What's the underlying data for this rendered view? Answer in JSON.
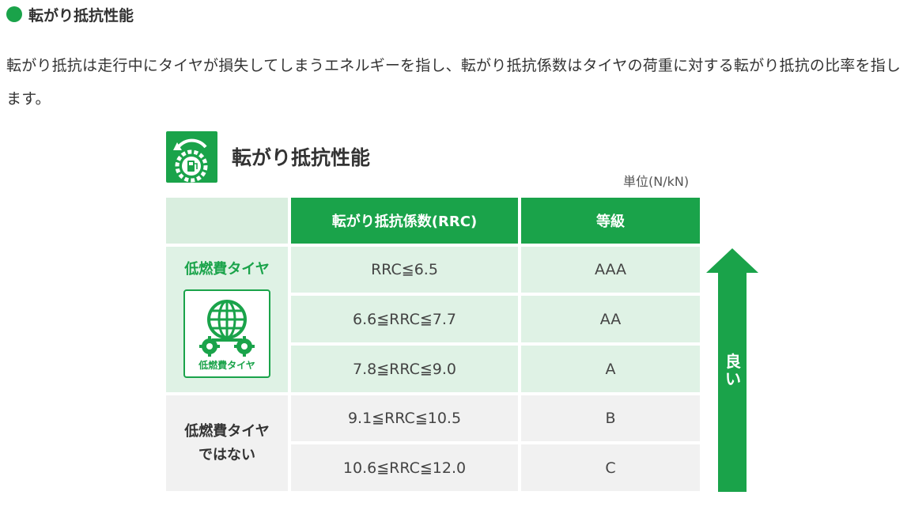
{
  "section": {
    "heading": "転がり抵抗性能",
    "description": "転がり抵抗は走行中にタイヤが損失してしまうエネルギーを指し、転がり抵抗係数はタイヤの荷重に対する転がり抵抗の比率を指します。"
  },
  "card": {
    "title": "転がり抵抗性能",
    "unit": "単位(N/kN)",
    "header": {
      "rrc": "転がり抵抗係数(RRC)",
      "grade": "等級"
    },
    "groups": {
      "low_fuel": "低燃費タイヤ",
      "not_low_fuel_line1": "低燃費タイヤ",
      "not_low_fuel_line2": "ではない",
      "badge_text": "低燃費タイヤ"
    },
    "rows": [
      {
        "rrc": "RRC≦6.5",
        "grade": "AAA"
      },
      {
        "rrc": "6.6≦RRC≦7.7",
        "grade": "AA"
      },
      {
        "rrc": "7.8≦RRC≦9.0",
        "grade": "A"
      },
      {
        "rrc": "9.1≦RRC≦10.5",
        "grade": "B"
      },
      {
        "rrc": "10.6≦RRC≦12.0",
        "grade": "C"
      }
    ],
    "arrow_label_1": "良",
    "arrow_label_2": "い"
  },
  "colors": {
    "brand_green": "#1aa34a",
    "light_green": "#dff2e5",
    "light_gray": "#f1f1f1"
  },
  "icons": [
    "tire-fuel-icon",
    "globe-gear-icon",
    "up-arrow-icon"
  ]
}
